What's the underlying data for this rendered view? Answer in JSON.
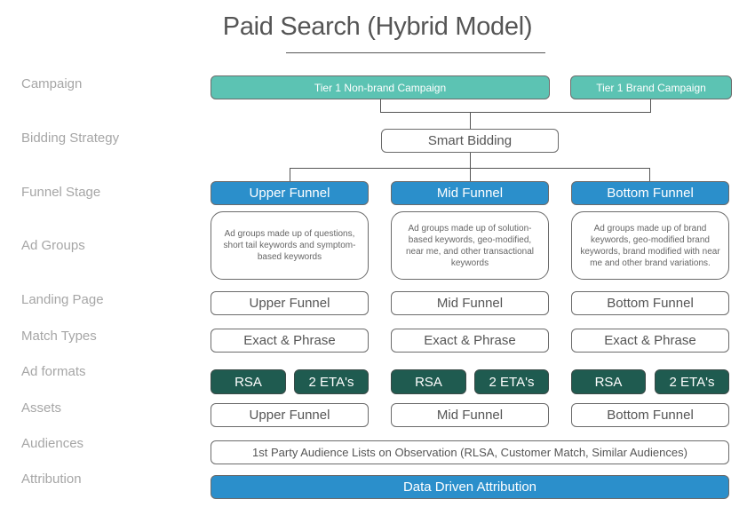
{
  "title": "Paid Search (Hybrid Model)",
  "row_labels": [
    "Campaign",
    "Bidding Strategy",
    "Funnel Stage",
    "Ad Groups",
    "Landing Page",
    "Match Types",
    "Ad formats",
    "Assets",
    "Audiences",
    "Attribution"
  ],
  "campaigns": [
    "Tier 1 Non-brand Campaign",
    "Tier 1 Brand Campaign"
  ],
  "bidding": "Smart Bidding",
  "funnel_stages": [
    "Upper Funnel",
    "Mid Funnel",
    "Bottom Funnel"
  ],
  "ad_groups": [
    "Ad groups made up of questions, short tail keywords and symptom-based keywords",
    "Ad groups made up of solution-based keywords, geo-modified, near me, and other transactional keywords",
    "Ad groups made up of brand keywords, geo-modified brand keywords, brand modified with near me and other brand variations."
  ],
  "landing_pages": [
    "Upper Funnel",
    "Mid Funnel",
    "Bottom Funnel"
  ],
  "match_types": [
    "Exact & Phrase",
    "Exact & Phrase",
    "Exact & Phrase"
  ],
  "ad_formats": [
    {
      "a": "RSA",
      "b": "2 ETA's"
    },
    {
      "a": "RSA",
      "b": "2 ETA's"
    },
    {
      "a": "RSA",
      "b": "2 ETA's"
    }
  ],
  "assets": [
    "Upper Funnel",
    "Mid Funnel",
    "Bottom Funnel"
  ],
  "audiences": "1st Party Audience Lists on Observation (RLSA, Customer Match, Similar Audiences)",
  "attribution": "Data Driven Attribution",
  "colors": {
    "campaign": "#5cc3b3",
    "funnel": "#2b8fcb",
    "ad_format": "#1f5b50",
    "label": "#a6a6a6"
  }
}
